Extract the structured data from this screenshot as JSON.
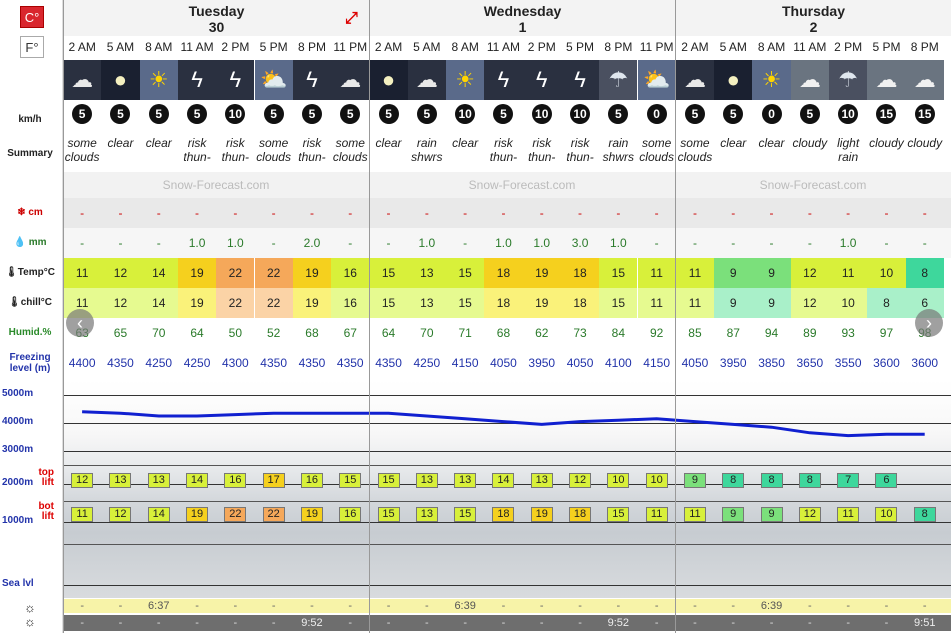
{
  "units": {
    "celsius": "C°",
    "fahrenheit": "F°"
  },
  "labels": {
    "wind": "km/h",
    "summary": "Summary",
    "snow": "cm",
    "rain": "mm",
    "temp": "Temp°C",
    "chill": "chill°C",
    "humid": "Humid.%",
    "freezing_line1": "Freezing",
    "freezing_line2": "level (m)",
    "alt": [
      "5000m",
      "4000m",
      "3000m",
      "2000m",
      "1000m",
      "Sea lvl"
    ],
    "top_lift_1": "top",
    "top_lift_2": "lift",
    "bot_lift_1": "bot",
    "bot_lift_2": "lift"
  },
  "logo_text": "Snow-Forecast.com",
  "days": [
    {
      "name": "Tuesday",
      "num": "30"
    },
    {
      "name": "Wednesday",
      "num": "1"
    },
    {
      "name": "Thursday",
      "num": "2"
    }
  ],
  "times": [
    "2 AM",
    "5 AM",
    "8 AM",
    "11 AM",
    "2 PM",
    "5 PM",
    "8 PM",
    "11 PM",
    "2 AM",
    "5 AM",
    "8 AM",
    "11 AM",
    "2 PM",
    "5 PM",
    "8 PM",
    "11 PM",
    "2 AM",
    "5 AM",
    "8 AM",
    "11 AM",
    "2 PM",
    "5 PM",
    "8 PM"
  ],
  "icons": [
    "moon-cloud-icon",
    "moon-icon",
    "sun-icon",
    "lightning-icon",
    "lightning-icon",
    "sun-cloud-icon",
    "lightning-icon",
    "moon-cloud-icon",
    "moon-icon",
    "moon-cloud-icon",
    "sun-icon",
    "lightning-icon",
    "lightning-icon",
    "lightning-icon",
    "rain-cloud-icon",
    "sun-cloud-icon",
    "moon-cloud-icon",
    "moon-icon",
    "sun-icon",
    "cloud-icon",
    "rain-cloud-icon",
    "cloud-icon",
    "cloud-icon"
  ],
  "wind": [
    "5",
    "5",
    "5",
    "5",
    "10",
    "5",
    "5",
    "5",
    "5",
    "5",
    "10",
    "5",
    "10",
    "10",
    "5",
    "0",
    "5",
    "5",
    "0",
    "5",
    "10",
    "15",
    "15"
  ],
  "summary": [
    [
      "some",
      "clouds"
    ],
    [
      "clear",
      ""
    ],
    [
      "clear",
      ""
    ],
    [
      "risk",
      "thun-"
    ],
    [
      "risk",
      "thun-"
    ],
    [
      "some",
      "clouds"
    ],
    [
      "risk",
      "thun-"
    ],
    [
      "some",
      "clouds"
    ],
    [
      "clear",
      ""
    ],
    [
      "rain",
      "shwrs"
    ],
    [
      "clear",
      ""
    ],
    [
      "risk",
      "thun-"
    ],
    [
      "risk",
      "thun-"
    ],
    [
      "risk",
      "thun-"
    ],
    [
      "rain",
      "shwrs"
    ],
    [
      "some",
      "clouds"
    ],
    [
      "some",
      "clouds"
    ],
    [
      "clear",
      ""
    ],
    [
      "clear",
      ""
    ],
    [
      "cloudy",
      ""
    ],
    [
      "light",
      "rain"
    ],
    [
      "cloudy",
      ""
    ],
    [
      "cloudy",
      ""
    ]
  ],
  "snow": [
    "-",
    "-",
    "-",
    "-",
    "-",
    "-",
    "-",
    "-",
    "-",
    "-",
    "-",
    "-",
    "-",
    "-",
    "-",
    "-",
    "-",
    "-",
    "-",
    "-",
    "-",
    "-",
    "-"
  ],
  "rain": [
    "-",
    "-",
    "-",
    "1.0",
    "1.0",
    "-",
    "2.0",
    "-",
    "-",
    "1.0",
    "-",
    "1.0",
    "1.0",
    "3.0",
    "1.0",
    "-",
    "-",
    "-",
    "-",
    "-",
    "1.0",
    "-",
    "-"
  ],
  "temp": [
    "11",
    "12",
    "14",
    "19",
    "22",
    "22",
    "19",
    "16",
    "15",
    "13",
    "15",
    "18",
    "19",
    "18",
    "15",
    "11",
    "11",
    "9",
    "9",
    "12",
    "11",
    "10",
    "8"
  ],
  "chill": [
    "11",
    "12",
    "14",
    "19",
    "22",
    "22",
    "19",
    "16",
    "15",
    "13",
    "15",
    "18",
    "19",
    "18",
    "15",
    "11",
    "11",
    "9",
    "9",
    "12",
    "10",
    "8",
    "6"
  ],
  "humid": [
    "63",
    "65",
    "70",
    "64",
    "50",
    "52",
    "68",
    "67",
    "64",
    "70",
    "71",
    "68",
    "62",
    "73",
    "84",
    "92",
    "85",
    "87",
    "94",
    "89",
    "93",
    "97",
    "98"
  ],
  "freezing": [
    "4400",
    "4350",
    "4250",
    "4250",
    "4300",
    "4350",
    "4350",
    "4350",
    "4350",
    "4250",
    "4150",
    "4050",
    "3950",
    "4050",
    "4100",
    "4150",
    "4050",
    "3950",
    "3850",
    "3650",
    "3550",
    "3600",
    "3600"
  ],
  "top_lift": [
    "12",
    "13",
    "13",
    "14",
    "16",
    "17",
    "16",
    "15",
    "15",
    "13",
    "13",
    "14",
    "13",
    "12",
    "10",
    "10",
    "9",
    "8",
    "8",
    "8",
    "7",
    "6"
  ],
  "bot_lift": [
    "11",
    "12",
    "14",
    "19",
    "22",
    "22",
    "19",
    "16",
    "15",
    "13",
    "15",
    "18",
    "19",
    "18",
    "15",
    "11",
    "11",
    "9",
    "9",
    "12",
    "11",
    "10",
    "8"
  ],
  "sunrise": [
    "6:37",
    "6:39",
    "6:39"
  ],
  "sunset": [
    "9:52",
    "9:52",
    "9:51"
  ],
  "colors": {
    "temp_hot": "#f5a85a",
    "temp_warm": "#f5d01e",
    "temp_mild": "#d8f03a",
    "temp_cool": "#7be07b",
    "temp_cold": "#3ed79c"
  }
}
